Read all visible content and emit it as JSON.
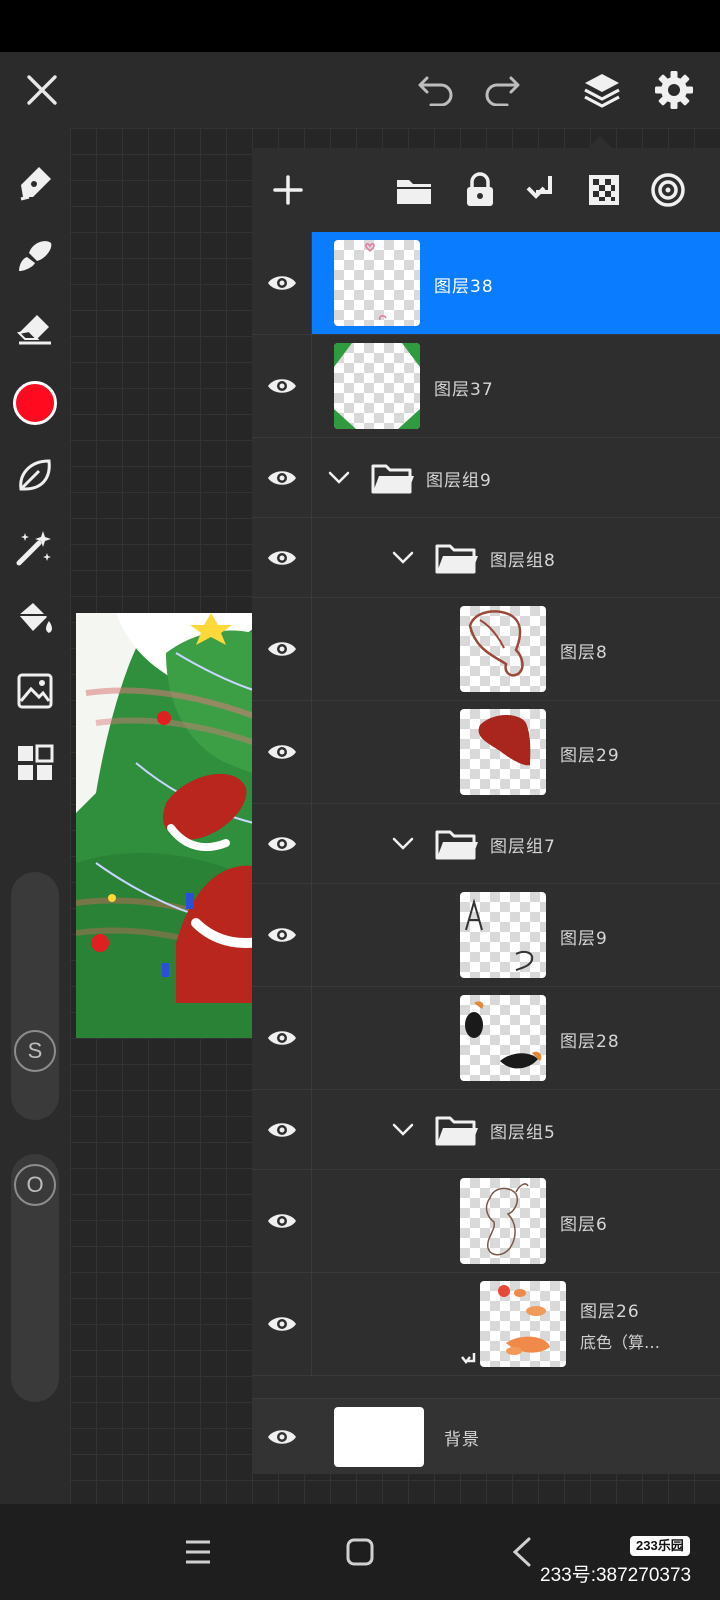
{
  "app": {
    "colors": {
      "accent": "#0a7cff",
      "current_color": "#ff0a1e",
      "panel_bg": "#2e2e2e",
      "toolbar_bg": "#2b2b2b"
    }
  },
  "topbar": {
    "icons": [
      "close-icon",
      "undo-icon",
      "redo-icon",
      "layers-icon",
      "gear-icon"
    ]
  },
  "tools": [
    "pen-icon",
    "brush-icon",
    "eraser-icon",
    "color-swatch",
    "smudge-icon",
    "magic-wand-icon",
    "fill-bucket-icon",
    "image-icon",
    "grid-icon"
  ],
  "sliders": {
    "size_label": "S",
    "opacity_label": "O"
  },
  "layer_panel": {
    "actions": [
      "add-icon",
      "folder-icon",
      "lock-icon",
      "merge-down-icon",
      "transparency-icon",
      "blend-icon"
    ],
    "layers": [
      {
        "name": "图层38",
        "type": "layer",
        "selected": true
      },
      {
        "name": "图层37",
        "type": "layer"
      },
      {
        "name": "图层组9",
        "type": "group",
        "expanded": true
      },
      {
        "name": "图层组8",
        "type": "group",
        "expanded": true
      },
      {
        "name": "图层8",
        "type": "layer"
      },
      {
        "name": "图层29",
        "type": "layer"
      },
      {
        "name": "图层组7",
        "type": "group",
        "expanded": true
      },
      {
        "name": "图层9",
        "type": "layer"
      },
      {
        "name": "图层28",
        "type": "layer"
      },
      {
        "name": "图层组5",
        "type": "group",
        "expanded": true
      },
      {
        "name": "图层6",
        "type": "layer"
      },
      {
        "name": "图层26",
        "sub": "底色（算…",
        "type": "layer",
        "clipped": true
      }
    ],
    "background_layer": {
      "name": "背景"
    }
  },
  "navbar": {
    "watermark_badge": "233乐园",
    "watermark_id": "233号:387270373"
  }
}
